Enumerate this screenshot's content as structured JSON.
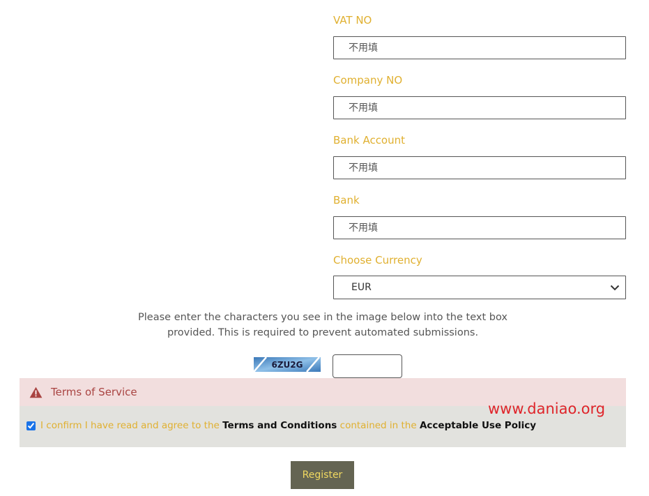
{
  "fields": [
    {
      "label": "VAT NO",
      "placeholder": "不用填"
    },
    {
      "label": "Company NO",
      "placeholder": "不用填"
    },
    {
      "label": "Bank Account",
      "placeholder": "不用填"
    },
    {
      "label": "Bank",
      "placeholder": "不用填"
    }
  ],
  "currency": {
    "label": "Choose Currency",
    "selected": "EUR"
  },
  "captcha": {
    "instructions_line1": "Please enter the characters you see in the image below into the text box",
    "instructions_line2": "provided. This is required to prevent automated submissions.",
    "image_text": "6ZU2G",
    "input_value": ""
  },
  "tos": {
    "title": "Terms of Service",
    "agree_prefix": "I confirm I have read and agree to the",
    "terms_link": "Terms and Conditions",
    "agree_middle": "contained in the",
    "policy_link": "Acceptable Use Policy",
    "checked": true
  },
  "watermark": "www.daniao.org",
  "register_label": "Register",
  "colors": {
    "label_gold": "#e0b030",
    "alert_bg": "#f2dede",
    "alert_text": "#a94442",
    "button_bg": "#646452",
    "button_text": "#f0d860"
  },
  "icons": {
    "alert": "warning-triangle-icon",
    "select": "chevron-down-icon"
  }
}
